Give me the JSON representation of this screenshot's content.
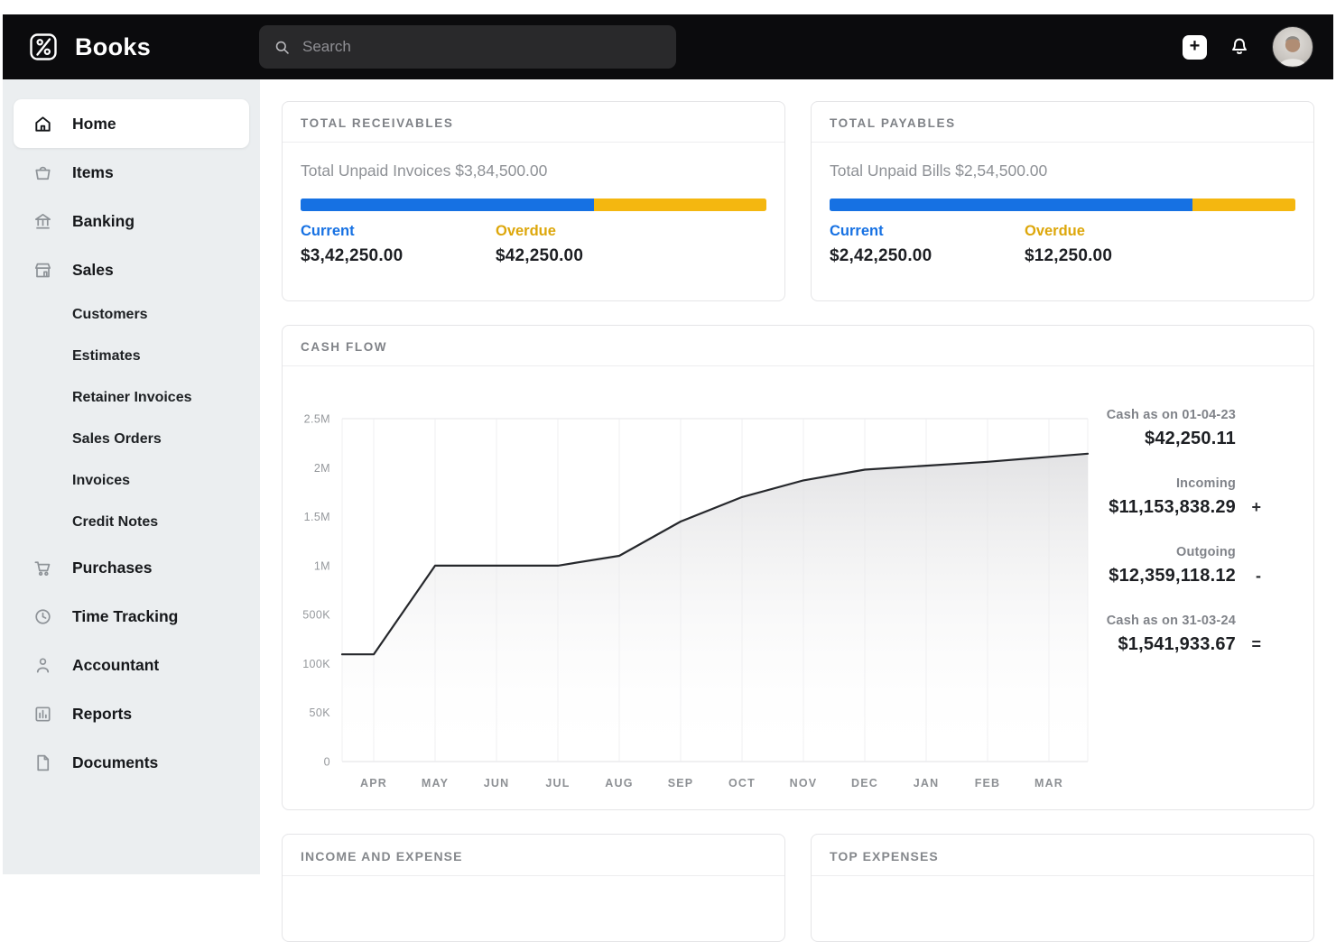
{
  "topbar": {
    "brand": "Books",
    "search_placeholder": "Search",
    "plus_label": "+"
  },
  "colors": {
    "current_blue": "#1671e3",
    "overdue_yellow": "#f4b710",
    "overdue_label_yellow": "#dda70b",
    "topbar_bg": "#0b0b0d",
    "sidebar_bg": "#ebeef0",
    "chart_line": "#26282c"
  },
  "sidebar": {
    "items": [
      {
        "label": "Home",
        "type": "main",
        "active": true
      },
      {
        "label": "Items",
        "type": "main"
      },
      {
        "label": "Banking",
        "type": "main"
      },
      {
        "label": "Sales",
        "type": "main"
      },
      {
        "label": "Customers",
        "type": "sub"
      },
      {
        "label": "Estimates",
        "type": "sub"
      },
      {
        "label": "Retainer Invoices",
        "type": "sub"
      },
      {
        "label": "Sales Orders",
        "type": "sub"
      },
      {
        "label": "Invoices",
        "type": "sub"
      },
      {
        "label": "Credit Notes",
        "type": "sub"
      },
      {
        "label": "Purchases",
        "type": "main"
      },
      {
        "label": "Time Tracking",
        "type": "main"
      },
      {
        "label": "Accountant",
        "type": "main"
      },
      {
        "label": "Reports",
        "type": "main"
      },
      {
        "label": "Documents",
        "type": "main"
      }
    ]
  },
  "cards": {
    "receivables": {
      "title": "TOTAL RECEIVABLES",
      "subtitle": "Total Unpaid Invoices $3,84,500.00",
      "current_label": "Current",
      "current_value": "$3,42,250.00",
      "overdue_label": "Overdue",
      "overdue_value": "$42,250.00",
      "current_pct": 63
    },
    "payables": {
      "title": "TOTAL PAYABLES",
      "subtitle": "Total Unpaid Bills $2,54,500.00",
      "current_label": "Current",
      "current_value": "$2,42,250.00",
      "overdue_label": "Overdue",
      "overdue_value": "$12,250.00",
      "current_pct": 78
    },
    "cashflow": {
      "title": "CASH FLOW",
      "stats": [
        {
          "label": "Cash as on 01-04-23",
          "amount": "$42,250.11",
          "op": ""
        },
        {
          "label": "Incoming",
          "amount": "$11,153,838.29",
          "op": "+"
        },
        {
          "label": "Outgoing",
          "amount": "$12,359,118.12",
          "op": "-"
        },
        {
          "label": "Cash as on 31-03-24",
          "amount": "$1,541,933.67",
          "op": "="
        }
      ]
    },
    "income_expense": {
      "title": "INCOME AND EXPENSE"
    },
    "top_expenses": {
      "title": "TOP EXPENSES"
    }
  },
  "chart_data": {
    "type": "area",
    "title": "CASH FLOW",
    "x": [
      "APR",
      "MAY",
      "JUN",
      "JUL",
      "AUG",
      "SEP",
      "OCT",
      "NOV",
      "DEC",
      "JAN",
      "FEB",
      "MAR"
    ],
    "values": [
      175000,
      1000000,
      1000000,
      1000000,
      1100000,
      1450000,
      1700000,
      1870000,
      1980000,
      2020000,
      2060000,
      2110000
    ],
    "ytick_labels": [
      "2.5M",
      "2M",
      "1.5M",
      "1M",
      "500K",
      "100K",
      "50K",
      "0"
    ],
    "ytick_values": [
      2500000,
      2000000,
      1500000,
      1000000,
      500000,
      100000,
      50000,
      0
    ],
    "yaxis_note": "ticks evenly spaced (non-linear scale)",
    "grid": "vertical month gridlines only",
    "legend_position": "none"
  }
}
